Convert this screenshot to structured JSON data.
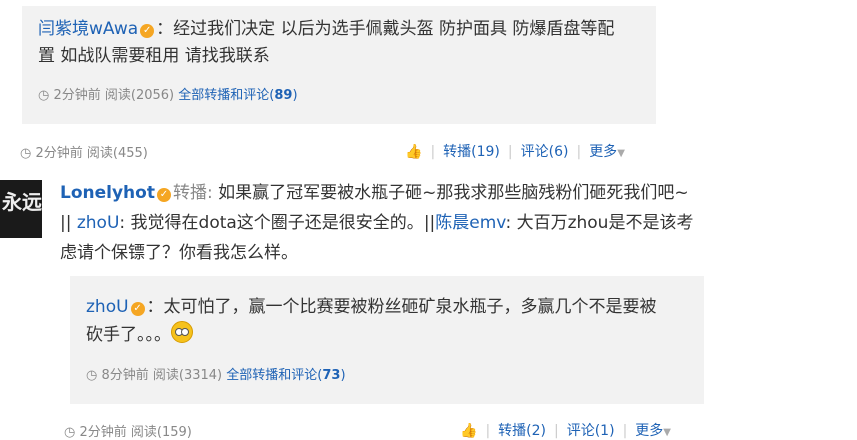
{
  "quote1": {
    "user": "闫紫境wAwa",
    "text_line1": "：经过我们决定 以后为选手佩戴头盔 防护面具 防爆盾盘等配",
    "text_line2": "置 如战队需要租用 请找我联系",
    "time": "2分钟前",
    "reads": "阅读(2056)",
    "all_label": "全部转播和评论(",
    "all_count": "89",
    "all_close": ")"
  },
  "post1_meta": {
    "time": "2分钟前",
    "reads": "阅读(455)",
    "repost": "转播(19)",
    "comment": "评论(6)",
    "more": "更多"
  },
  "post2": {
    "user": "Lonelyhot",
    "repost_label": "转播:",
    "text1": " 如果赢了冠军要被水瓶子砸~那我求那些脑残粉们砸死我们吧~",
    "sep1": "|| ",
    "user2": "zhoU",
    "text2": ": 我觉得在dota这个圈子还是很安全的。",
    "sep2": "||",
    "user3": "陈晨emv",
    "text3": ": 大百万zhou是不是该考",
    "text4": "虑请个保镖了？你看我怎么样。",
    "avatar_text": "永远"
  },
  "quote2": {
    "user": "zhoU",
    "text_line1": "：太可怕了，赢一个比赛要被粉丝砸矿泉水瓶子，多赢几个不是要被",
    "text_line2": "砍手了。。。",
    "time": "8分钟前",
    "reads": "阅读(3314)",
    "all_label": "全部转播和评论(",
    "all_count": "73",
    "all_close": ")"
  },
  "post2_meta": {
    "time": "2分钟前",
    "reads": "阅读(159)",
    "repost": "转播(2)",
    "comment": "评论(1)",
    "more": "更多"
  },
  "icons": {
    "verified": "verified-badge-icon",
    "clock": "clock-icon",
    "like": "thumbs-up-icon",
    "dropdown": "chevron-down-icon",
    "emoji": "surprised-emoji-icon"
  },
  "colors": {
    "link": "#1e62b5",
    "quote_bg": "#f2f2f2",
    "badge": "#f5a623"
  }
}
